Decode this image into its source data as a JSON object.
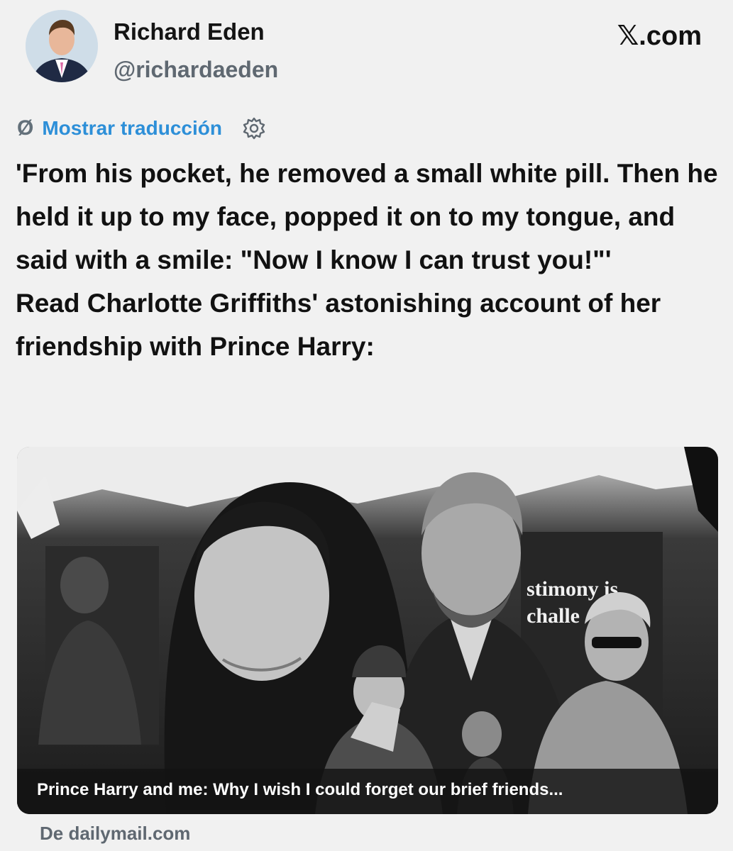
{
  "author": {
    "name": "Richard Eden",
    "handle": "@richardaeden"
  },
  "brand": "𝕏.com",
  "translate": {
    "icon": "no-translate-icon",
    "label": "Mostrar traducción",
    "settings_icon": "gear-icon"
  },
  "tweet": {
    "quote": "'From his pocket, he removed a small white pill. Then he held it up to my face, popped it on to my tongue, and said with a smile: \"Now I know I can trust you!\"'",
    "body": "Read Charlotte Griffiths' astonishing account of her friendship with Prince Harry:"
  },
  "link_card": {
    "headline": "Prince Harry and me: Why I wish I could forget our brief friends...",
    "image_overlay_text": [
      "stimony is",
      "challe"
    ],
    "source": "De dailymail.com"
  }
}
